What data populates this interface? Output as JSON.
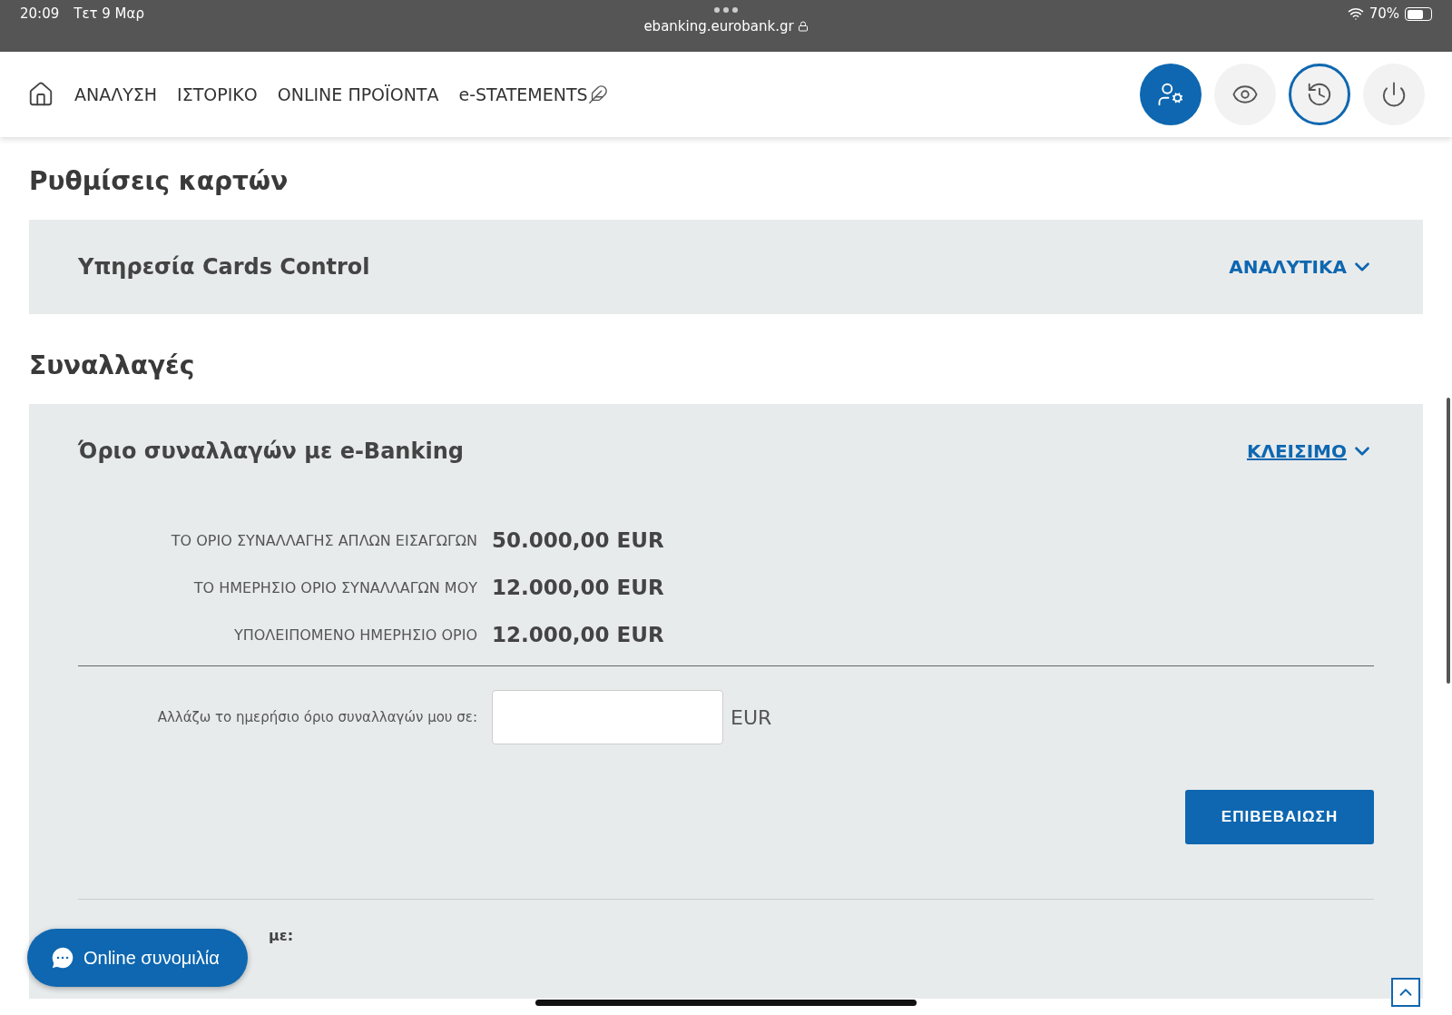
{
  "status_bar": {
    "time": "20:09",
    "date": "Τετ 9 Μαρ",
    "url": "ebanking.eurobank.gr",
    "battery": "70%"
  },
  "nav": {
    "items": [
      "ΑΝΑΛΥΣΗ",
      "ΙΣΤΟΡΙΚΟ",
      "ONLINE ΠΡΟΪΟΝΤΑ",
      "e-STATEMENTS"
    ],
    "actions": [
      {
        "kind": "profile",
        "selected": true,
        "focused": false
      },
      {
        "kind": "eye",
        "selected": false,
        "focused": false
      },
      {
        "kind": "history",
        "selected": false,
        "focused": true
      },
      {
        "kind": "power",
        "selected": false,
        "focused": false
      }
    ]
  },
  "sections": [
    {
      "title": "Ρυθμίσεις καρτών",
      "panel": {
        "title": "Υπηρεσία Cards Control",
        "toggle": "ΑΝΑΛΥΤΙΚΑ",
        "expanded": false
      }
    },
    {
      "title": "Συναλλαγές",
      "panel": {
        "title": "Όριο συναλλαγών με e-Banking",
        "toggle": "ΚΛΕΙΣΙΜΟ",
        "expanded": true,
        "rows": [
          {
            "label": "ΤΟ ΟΡΙΟ ΣΥΝΑΛΛΑΓΗΣ ΑΠΛΩΝ ΕΙΣΑΓΩΓΩΝ",
            "value": "50.000,00 EUR"
          },
          {
            "label": "ΤΟ ΗΜΕΡΗΣΙΟ ΟΡΙΟ ΣΥΝΑΛΛΑΓΩΝ ΜΟΥ",
            "value": "12.000,00 EUR"
          },
          {
            "label": "ΥΠΟΛΕΙΠΟΜΕΝΟ ΗΜΕΡΗΣΙΟ ΟΡΙΟ",
            "value": "12.000,00 EUR"
          }
        ],
        "change_label": "Αλλάζω το ημερήσιο όριο συναλλαγών μου σε:",
        "currency": "EUR",
        "confirm": "ΕΠΙΒΕΒΑΙΩΣΗ",
        "note_heading": "με:"
      }
    }
  ],
  "chat": {
    "label": "Online συνομιλία"
  }
}
